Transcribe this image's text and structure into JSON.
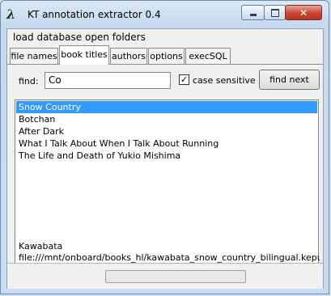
{
  "window": {
    "title": "KT annotation extractor 0.4",
    "icon": "lambda-icon"
  },
  "menubar": {
    "items": [
      "load database",
      "open folders"
    ]
  },
  "tabs": [
    {
      "label": "file names",
      "active": false
    },
    {
      "label": "book titles",
      "active": true
    },
    {
      "label": "authors",
      "active": false
    },
    {
      "label": "options",
      "active": false
    },
    {
      "label": "execSQL",
      "active": false
    }
  ],
  "search": {
    "label": "find:",
    "value": "Co",
    "case_sensitive_label": "case sensitive",
    "case_sensitive_checked": true,
    "find_next_label": "find next"
  },
  "results": {
    "items": [
      "Snow Country",
      "Botchan",
      "After Dark",
      "What I Talk About When I Talk About Running",
      "The Life and Death of Yukio Mishima"
    ],
    "selected_index": 0
  },
  "details": {
    "author": "Kawabata",
    "path": "file:///mnt/onboard/books_hl/kawabata_snow_country_bilingual.kepub.epub"
  },
  "status": {
    "progress": 0
  },
  "colors": {
    "selection": "#3399ff",
    "close_button": "#c64532"
  }
}
